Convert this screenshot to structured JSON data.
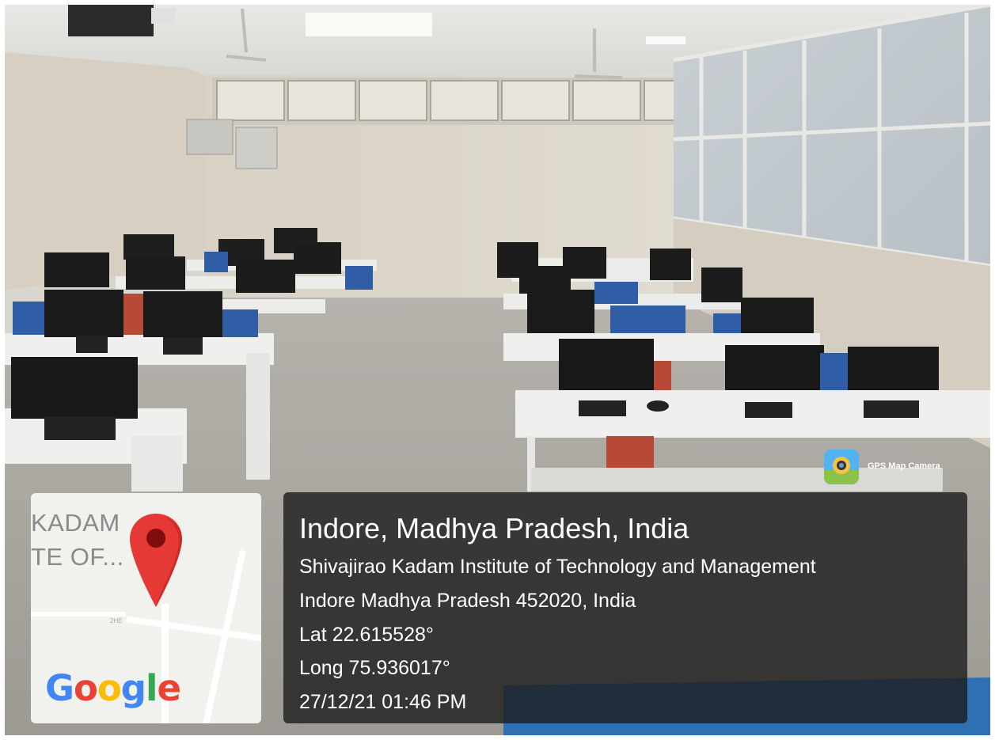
{
  "photo": {
    "description_icon": "computer-lab-photo"
  },
  "map": {
    "label_line1": "KADAM",
    "label_line2": "TE OF...",
    "road_number": "2HE",
    "pin_icon": "map-pin-icon",
    "logo_text_parts": [
      "G",
      "o",
      "o",
      "g",
      "l",
      "e"
    ]
  },
  "info": {
    "title": "Indore, Madhya Pradesh, India",
    "line1": "Shivajirao Kadam Institute of Technology and Management",
    "line2": "Indore Madhya Pradesh 452020, India",
    "lat": "Lat 22.615528°",
    "long": "Long 75.936017°",
    "datetime": "27/12/21 01:46 PM"
  },
  "badge": {
    "text": "GPS Map Camera",
    "icon": "gps-map-camera-icon"
  },
  "colors": {
    "google_blue": "#4285f4",
    "google_red": "#ea4335",
    "google_yellow": "#fbbc05",
    "google_green": "#34a853",
    "pin_red": "#e53935"
  }
}
